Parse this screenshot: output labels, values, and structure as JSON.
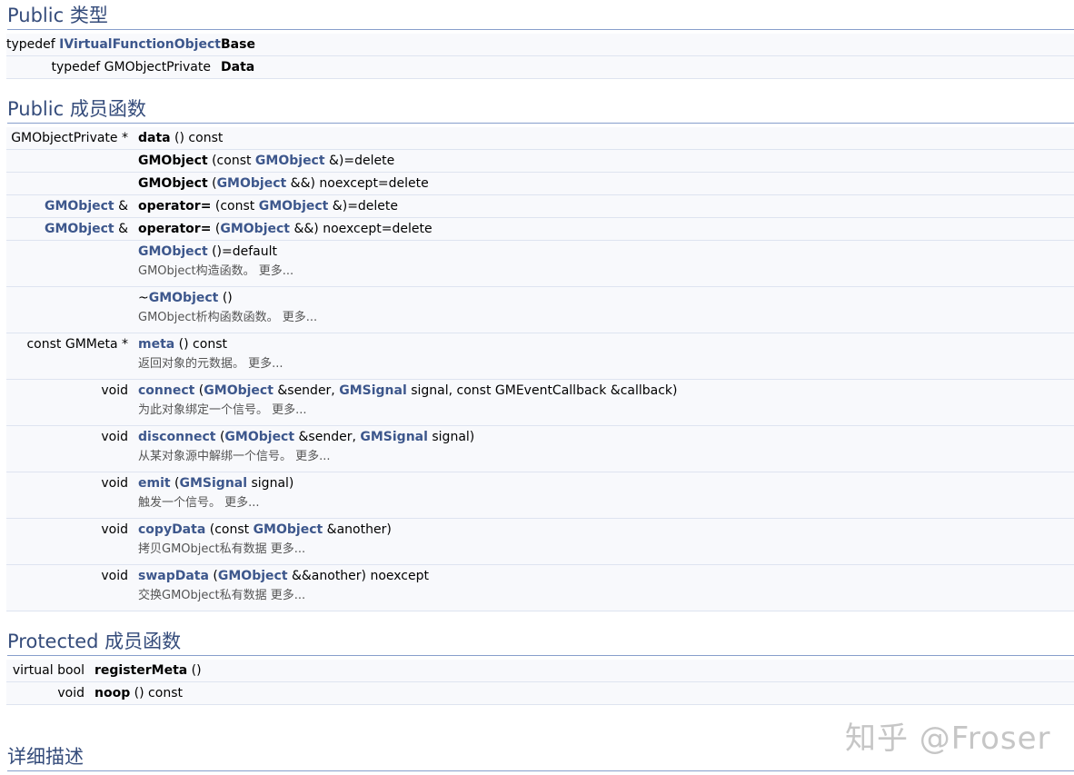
{
  "sections": {
    "public_types": {
      "title": "Public 类型"
    },
    "public_functions": {
      "title": "Public 成员函数"
    },
    "protected_functions": {
      "title": "Protected 成员函数"
    },
    "detailed": {
      "title": "详细描述"
    }
  },
  "types": [
    {
      "prefix": "typedef",
      "link": "IVirtualFunctionObject",
      "name": "Base"
    },
    {
      "prefix": "typedef GMObjectPrivate",
      "name": "Data"
    }
  ],
  "functions": {
    "f1": {
      "ret": "GMObjectPrivate *",
      "name": "data",
      "rest": " () const"
    },
    "f2": {
      "name": "GMObject",
      "p1": " (const ",
      "link": "GMObject",
      "p2": " &)=delete"
    },
    "f3": {
      "name": "GMObject",
      "p1": " (",
      "link": "GMObject",
      "p2": " &&) noexcept=delete"
    },
    "f4": {
      "ret_link": "GMObject",
      "ret_suffix": " &",
      "name": "operator=",
      "p1": " (const ",
      "link": "GMObject",
      "p2": " &)=delete"
    },
    "f5": {
      "ret_link": "GMObject",
      "ret_suffix": " &",
      "name": "operator=",
      "p1": " (",
      "link": "GMObject",
      "p2": " &&) noexcept=delete"
    },
    "f6": {
      "link": "GMObject",
      "rest": " ()=default",
      "desc": "GMObject构造函数。",
      "more": "更多..."
    },
    "f7": {
      "pre": "~",
      "link": "GMObject",
      "rest": " ()",
      "desc": "GMObject析构函数函数。",
      "more": "更多..."
    },
    "f8": {
      "ret": "const GMMeta *",
      "name": "meta",
      "rest": " () const",
      "desc": "返回对象的元数据。",
      "more": "更多..."
    },
    "f9": {
      "ret": "void",
      "name": "connect",
      "p1": " (",
      "link1": "GMObject",
      "p2": " &sender, ",
      "link2": "GMSignal",
      "p3": " signal, const GMEventCallback &callback)",
      "desc": "为此对象绑定一个信号。",
      "more": "更多..."
    },
    "f10": {
      "ret": "void",
      "name": "disconnect",
      "p1": " (",
      "link1": "GMObject",
      "p2": " &sender, ",
      "link2": "GMSignal",
      "p3": " signal)",
      "desc": "从某对象源中解绑一个信号。",
      "more": "更多..."
    },
    "f11": {
      "ret": "void",
      "name": "emit",
      "p1": " (",
      "link1": "GMSignal",
      "p2": " signal)",
      "desc": "触发一个信号。",
      "more": "更多..."
    },
    "f12": {
      "ret": "void",
      "name": "copyData",
      "p1": " (const ",
      "link1": "GMObject",
      "p2": " &another)",
      "desc": "拷贝GMObject私有数据",
      "more": "更多..."
    },
    "f13": {
      "ret": "void",
      "name": "swapData",
      "p1": " (",
      "link1": "GMObject",
      "p2": " &&another) noexcept",
      "desc": "交换GMObject私有数据",
      "more": "更多..."
    }
  },
  "protected": [
    {
      "ret": "virtual bool",
      "name": "registerMeta",
      "rest": " ()"
    },
    {
      "ret": "void",
      "name": "noop",
      "rest": " () const"
    }
  ],
  "watermark": "知乎 @Froser",
  "colors": {
    "heading": "#354c7b",
    "link": "#3d578c",
    "row_bg": "#f8f9fc",
    "rule": "#879ecb"
  }
}
